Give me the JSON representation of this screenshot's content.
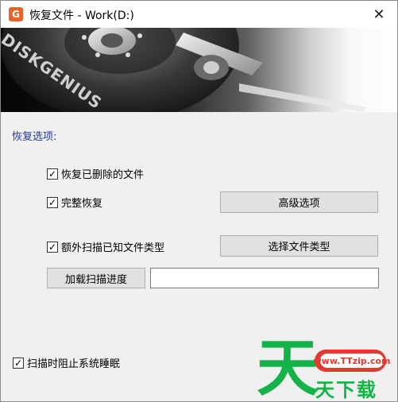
{
  "window": {
    "title": "恢复文件 - Work(D:)",
    "app_icon": "G",
    "close_label": "✕"
  },
  "banner": {
    "brand_text": "DISKGENIUS"
  },
  "options": {
    "section_label": "恢复选项:",
    "recover_deleted": {
      "label": "恢复已删除的文件",
      "checked": true
    },
    "full_recover": {
      "label": "完整恢复",
      "checked": true
    },
    "advanced_button": "高级选项",
    "extra_scan": {
      "label": "额外扫描已知文件类型",
      "checked": true
    },
    "select_types_button": "选择文件类型",
    "load_progress_button": "加载扫描进度",
    "progress_path_value": ""
  },
  "footer": {
    "prevent_sleep": {
      "label": "扫描时阻止系统睡眠",
      "checked": true
    }
  },
  "watermark": {
    "big_char": "天",
    "url": "www.TTzip.com",
    "sub": "天下载"
  }
}
